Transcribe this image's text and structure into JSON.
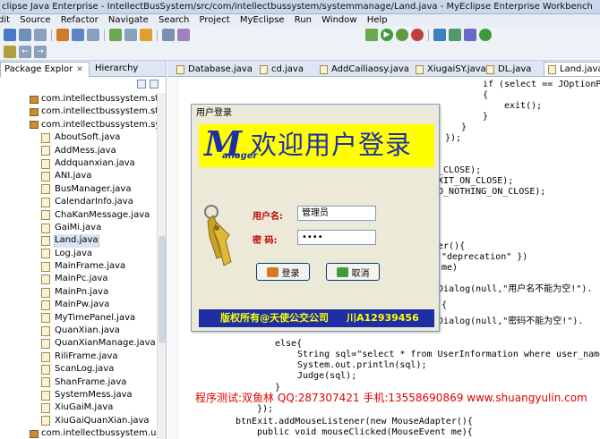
{
  "window": {
    "title": "clipse Java Enterprise - IntellectBusSystem/src/com/intellectbussystem/systemmanage/Land.java - MyEclipse Enterprise Workbench"
  },
  "menu": [
    "dit",
    "Source",
    "Refactor",
    "Navigate",
    "Search",
    "Project",
    "MyEclipse",
    "Run",
    "Window",
    "Help"
  ],
  "left_panel": {
    "tabs": [
      {
        "label": "Package Explor",
        "close": "✕"
      },
      {
        "label": "Hierarchy"
      }
    ],
    "tree": [
      {
        "type": "pkg",
        "label": "com.intellectbussystem.staffma"
      },
      {
        "type": "pkg",
        "label": "com.intellectbussystem.stopm"
      },
      {
        "type": "pkg",
        "label": "com.intellectbussystem.system"
      },
      {
        "type": "file",
        "label": "AboutSoft.java"
      },
      {
        "type": "file",
        "label": "AddMess.java"
      },
      {
        "type": "file",
        "label": "Addquanxian.java"
      },
      {
        "type": "file",
        "label": "ANI.java"
      },
      {
        "type": "file",
        "label": "BusManager.java"
      },
      {
        "type": "file",
        "label": "CalendarInfo.java"
      },
      {
        "type": "file",
        "label": "ChaKanMessage.java"
      },
      {
        "type": "file",
        "label": "GaiMi.java"
      },
      {
        "type": "file",
        "label": "Land.java",
        "selected": true
      },
      {
        "type": "file",
        "label": "Log.java"
      },
      {
        "type": "file",
        "label": "MainFrame.java"
      },
      {
        "type": "file",
        "label": "MainPc.java"
      },
      {
        "type": "file",
        "label": "MainPn.java"
      },
      {
        "type": "file",
        "label": "MainPw.java"
      },
      {
        "type": "file",
        "label": "MyTimePanel.java"
      },
      {
        "type": "file",
        "label": "QuanXian.java"
      },
      {
        "type": "file",
        "label": "QuanXianManage.java"
      },
      {
        "type": "file",
        "label": "RiliFrame.java"
      },
      {
        "type": "file",
        "label": "ScanLog.java"
      },
      {
        "type": "file",
        "label": "ShanFrame.java"
      },
      {
        "type": "file",
        "label": "SystemMess.java"
      },
      {
        "type": "file",
        "label": "XiuGaiM.java"
      },
      {
        "type": "file",
        "label": "XiuGaiQuanXian.java"
      },
      {
        "type": "pkg",
        "label": "com.intellectbussystem.userbe"
      }
    ]
  },
  "editor_tabs": [
    {
      "label": "Database.java"
    },
    {
      "label": "cd.java"
    },
    {
      "label": "AddCailiaosy.java"
    },
    {
      "label": "XiugaiSY.java"
    },
    {
      "label": "DL.java"
    },
    {
      "label": "Land.java",
      "active": true
    }
  ],
  "code_lines": [
    {
      "text": "if (select == JOptionPa"
    },
    {
      "text": "{"
    },
    {
      "text": "exit();"
    },
    {
      "text": "}"
    },
    {
      "text": "}"
    },
    {
      "text": "});"
    },
    {
      "text": "N_CLOSE);"
    },
    {
      "text": "EXIT_ON_CLOSE);"
    },
    {
      "text": "DO_NOTHING_ON_CLOSE);"
    },
    {
      "text": "ter(){"
    },
    {
      "text": "\"deprecation\" })"
    },
    {
      "text": "me)"
    },
    {
      "text": "geDialog(null,\"用户名不能为空!\")."
    },
    {
      "text": "{"
    },
    {
      "text": "geDialog(null,\"密码不能为空!\")."
    },
    {
      "text": "else{"
    },
    {
      "text": "String sql=\"select * from UserInformation where user_name ="
    },
    {
      "text": "System.out.println(sql);"
    },
    {
      "text": "Judge(sql);"
    },
    {
      "text": "}"
    },
    {
      "text": "});"
    },
    {
      "text": "btnExit.addMouseListener(new MouseAdapter(){"
    },
    {
      "text": "public void mouseClicked(MouseEvent me){"
    }
  ],
  "dialog": {
    "title": "用户登录",
    "banner_logo_letter": "M",
    "banner_logo_rest": "anager",
    "banner_text": "欢迎用户登录",
    "username_label": "用户名:",
    "username_value": "管理员",
    "password_label": "密  码:",
    "password_value": "••••",
    "login_button": "登录",
    "cancel_button": "取消",
    "footer_left": "版权所有@天使公交公司",
    "footer_right": "川A12939456"
  },
  "watermark": "程序测试:双鱼林 QQ:287307421 手机:13558690869 www.shuangyulin.com"
}
